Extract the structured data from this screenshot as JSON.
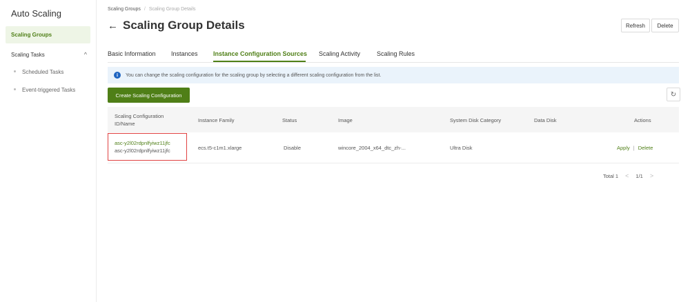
{
  "sidebar": {
    "title": "Auto Scaling",
    "active_item": "Scaling Groups",
    "group_label": "Scaling Tasks",
    "group_chevron": "^",
    "sub_items": [
      "Scheduled Tasks",
      "Event-triggered Tasks"
    ]
  },
  "breadcrumb": {
    "root": "Scaling Groups",
    "separator": "/",
    "current": "Scaling Group Details"
  },
  "header": {
    "back_arrow": "←",
    "title": "Scaling Group Details",
    "refresh_label": "Refresh",
    "delete_label": "Delete"
  },
  "tabs": [
    {
      "label": "Basic Information",
      "active": false
    },
    {
      "label": "Instances",
      "active": false
    },
    {
      "label": "Instance Configuration Sources",
      "active": true
    },
    {
      "label": "Scaling Activity",
      "active": false
    },
    {
      "label": "Scaling Rules",
      "active": false
    }
  ],
  "info_bar": {
    "icon": "i",
    "text": "You can change the scaling configuration for the scaling group by selecting a different scaling configuration from the list."
  },
  "create_button_label": "Create Scaling Configuration",
  "refresh_icon_glyph": "↻",
  "table": {
    "headers": {
      "id_name_line1": "Scaling Configuration",
      "id_name_line2": "ID/Name",
      "instance_family": "Instance Family",
      "status": "Status",
      "image": "Image",
      "system_disk": "System Disk Category",
      "data_disk": "Data Disk",
      "actions": "Actions"
    },
    "rows": [
      {
        "id": "asc-y2l02rdpnlfyiwz11jfc",
        "name": "asc-y2l02rdpnlfyiwz11jfc",
        "instance_family": "ecs.t5-c1m1.xlarge",
        "status": "Disable",
        "image": "wincore_2004_x64_dtc_zh-...",
        "system_disk": "Ultra Disk",
        "data_disk": "",
        "action_apply": "Apply",
        "action_separator": "|",
        "action_delete": "Delete"
      }
    ]
  },
  "pager": {
    "total_label": "Total 1",
    "prev": "<",
    "page": "1/1",
    "next": ">"
  },
  "colors": {
    "accent": "#4f7f17",
    "info_bg": "#eaf3fb",
    "highlight_border": "#e04040"
  }
}
